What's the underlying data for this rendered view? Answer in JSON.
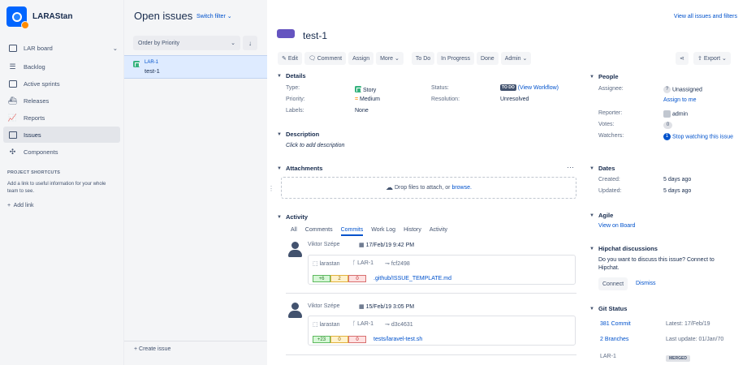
{
  "sidebar": {
    "project_name": "LARAStan",
    "board_selector": "LAR board",
    "items": [
      {
        "label": "Backlog"
      },
      {
        "label": "Active sprints"
      },
      {
        "label": "Releases"
      },
      {
        "label": "Reports"
      },
      {
        "label": "Issues"
      },
      {
        "label": "Components"
      }
    ],
    "shortcuts_heading": "PROJECT SHORTCUTS",
    "shortcuts_text": "Add a link to useful information for your whole team to see.",
    "add_link": "Add link"
  },
  "issue_list": {
    "title": "Open issues",
    "switch_filter": "Switch filter",
    "order_by": "Order by Priority",
    "issues": [
      {
        "key": "LAR-1",
        "summary": "test-1"
      }
    ],
    "create_issue": "Create issue"
  },
  "header": {
    "view_all": "View all issues and filters",
    "issue_title": "test-1"
  },
  "toolbar": {
    "edit": "Edit",
    "comment": "Comment",
    "assign": "Assign",
    "more": "More",
    "todo": "To Do",
    "in_progress": "In Progress",
    "done": "Done",
    "admin": "Admin",
    "export": "Export"
  },
  "details": {
    "heading": "Details",
    "type_label": "Type:",
    "type_value": "Story",
    "priority_label": "Priority:",
    "priority_value": "Medium",
    "labels_label": "Labels:",
    "labels_value": "None",
    "status_label": "Status:",
    "status_value": "TO DO",
    "view_workflow": "(View Workflow)",
    "resolution_label": "Resolution:",
    "resolution_value": "Unresolved"
  },
  "description": {
    "heading": "Description",
    "placeholder": "Click to add description"
  },
  "attachments": {
    "heading": "Attachments",
    "drop_text": "Drop files to attach, or",
    "browse": "browse."
  },
  "activity": {
    "heading": "Activity",
    "tabs": [
      "All",
      "Comments",
      "Commits",
      "Work Log",
      "History",
      "Activity"
    ],
    "commits": [
      {
        "author": "Viktor Szépe",
        "date": "17/Feb/19 9:42 PM",
        "repo": "larastan",
        "issue": "LAR-1",
        "hash": "fcf2498",
        "added": "+6",
        "modified": "2",
        "deleted": "0",
        "file": ".github/ISSUE_TEMPLATE.md"
      },
      {
        "author": "Viktor Szépe",
        "date": "15/Feb/19 3:05 PM",
        "repo": "larastan",
        "issue": "LAR-1",
        "hash": "d3c4631",
        "added": "+23",
        "modified": "0",
        "deleted": "0",
        "file": "tests/laravel-test.sh"
      }
    ]
  },
  "people": {
    "heading": "People",
    "assignee_label": "Assignee:",
    "assignee_value": "Unassigned",
    "assign_to_me": "Assign to me",
    "reporter_label": "Reporter:",
    "reporter_value": "admin",
    "votes_label": "Votes:",
    "votes_value": "0",
    "watchers_label": "Watchers:",
    "watchers_count": "1",
    "watchers_link": "Stop watching this issue"
  },
  "dates": {
    "heading": "Dates",
    "created_label": "Created:",
    "created_value": "5 days ago",
    "updated_label": "Updated:",
    "updated_value": "5 days ago"
  },
  "agile": {
    "heading": "Agile",
    "link": "View on Board"
  },
  "hipchat": {
    "heading": "Hipchat discussions",
    "text": "Do you want to discuss this issue? Connect to Hipchat.",
    "connect": "Connect",
    "dismiss": "Dismiss"
  },
  "git_status": {
    "heading": "Git Status",
    "commits": "381 Commit",
    "latest": "Latest: 17/Feb/19",
    "branches": "2 Branches",
    "last_update": "Last update: 01/Jan/70",
    "issue_key": "LAR-1",
    "merged": "MERGED"
  },
  "colors": {
    "accent": "#0052cc",
    "story": "#36b37e",
    "sidebar_bg": "#f4f5f7"
  }
}
